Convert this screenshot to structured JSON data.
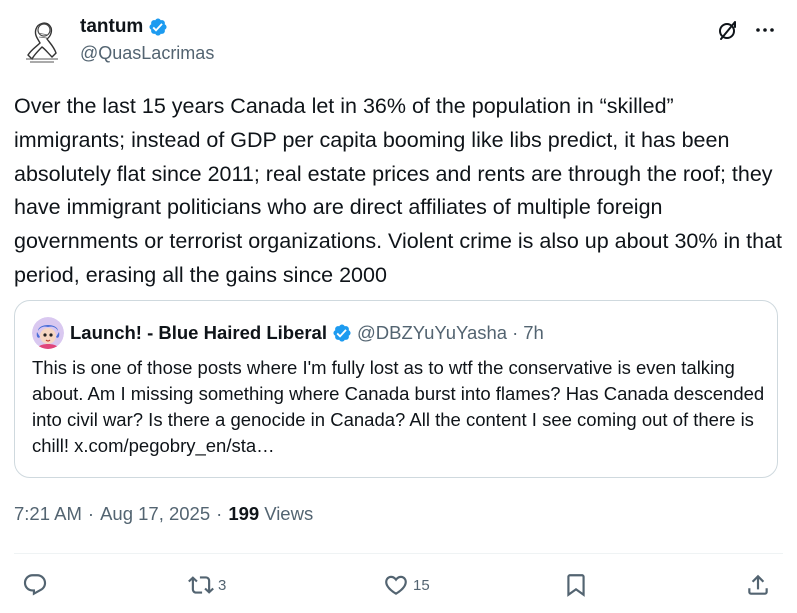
{
  "author": {
    "name": "tantum",
    "handle": "@QuasLacrimas",
    "verified": true
  },
  "tweet": {
    "text": "Over the last 15 years Canada let in 36% of the population in “skilled” immigrants; instead of GDP per capita booming like libs predict, it has been absolutely flat since 2011; real estate prices and rents are through the roof; they have immigrant politicians who are direct affiliates of multiple foreign governments or terrorist organizations. Violent crime is also up about 30% in that period, erasing all the gains since 2000"
  },
  "quote": {
    "name": "Launch! - Blue Haired Liberal",
    "handle": "@DBZYuYuYasha",
    "dot": "·",
    "time": "7h",
    "verified": true,
    "text": "This is one of those posts where I'm fully lost as to wtf the conservative is even talking about. Am I missing something where Canada burst into flames? Has Canada descended into civil war? Is there a genocide in Canada? All the content I see coming out of there is chill! x.com/pegobry_en/sta…"
  },
  "meta": {
    "time": "7:21 AM",
    "sep1": "·",
    "date": "Aug 17, 2025",
    "sep2": "·",
    "views_count": "199",
    "views_label": "Views"
  },
  "actions": {
    "retweets": "3",
    "likes": "15"
  },
  "colors": {
    "verified": "#1d9bf0",
    "secondary_text": "#536471",
    "primary_text": "#0f1419",
    "border": "#cfd9de"
  },
  "icons": [
    "grok-icon",
    "more-icon",
    "verified-badge-icon",
    "reply-icon",
    "retweet-icon",
    "like-icon",
    "bookmark-icon",
    "share-icon"
  ]
}
